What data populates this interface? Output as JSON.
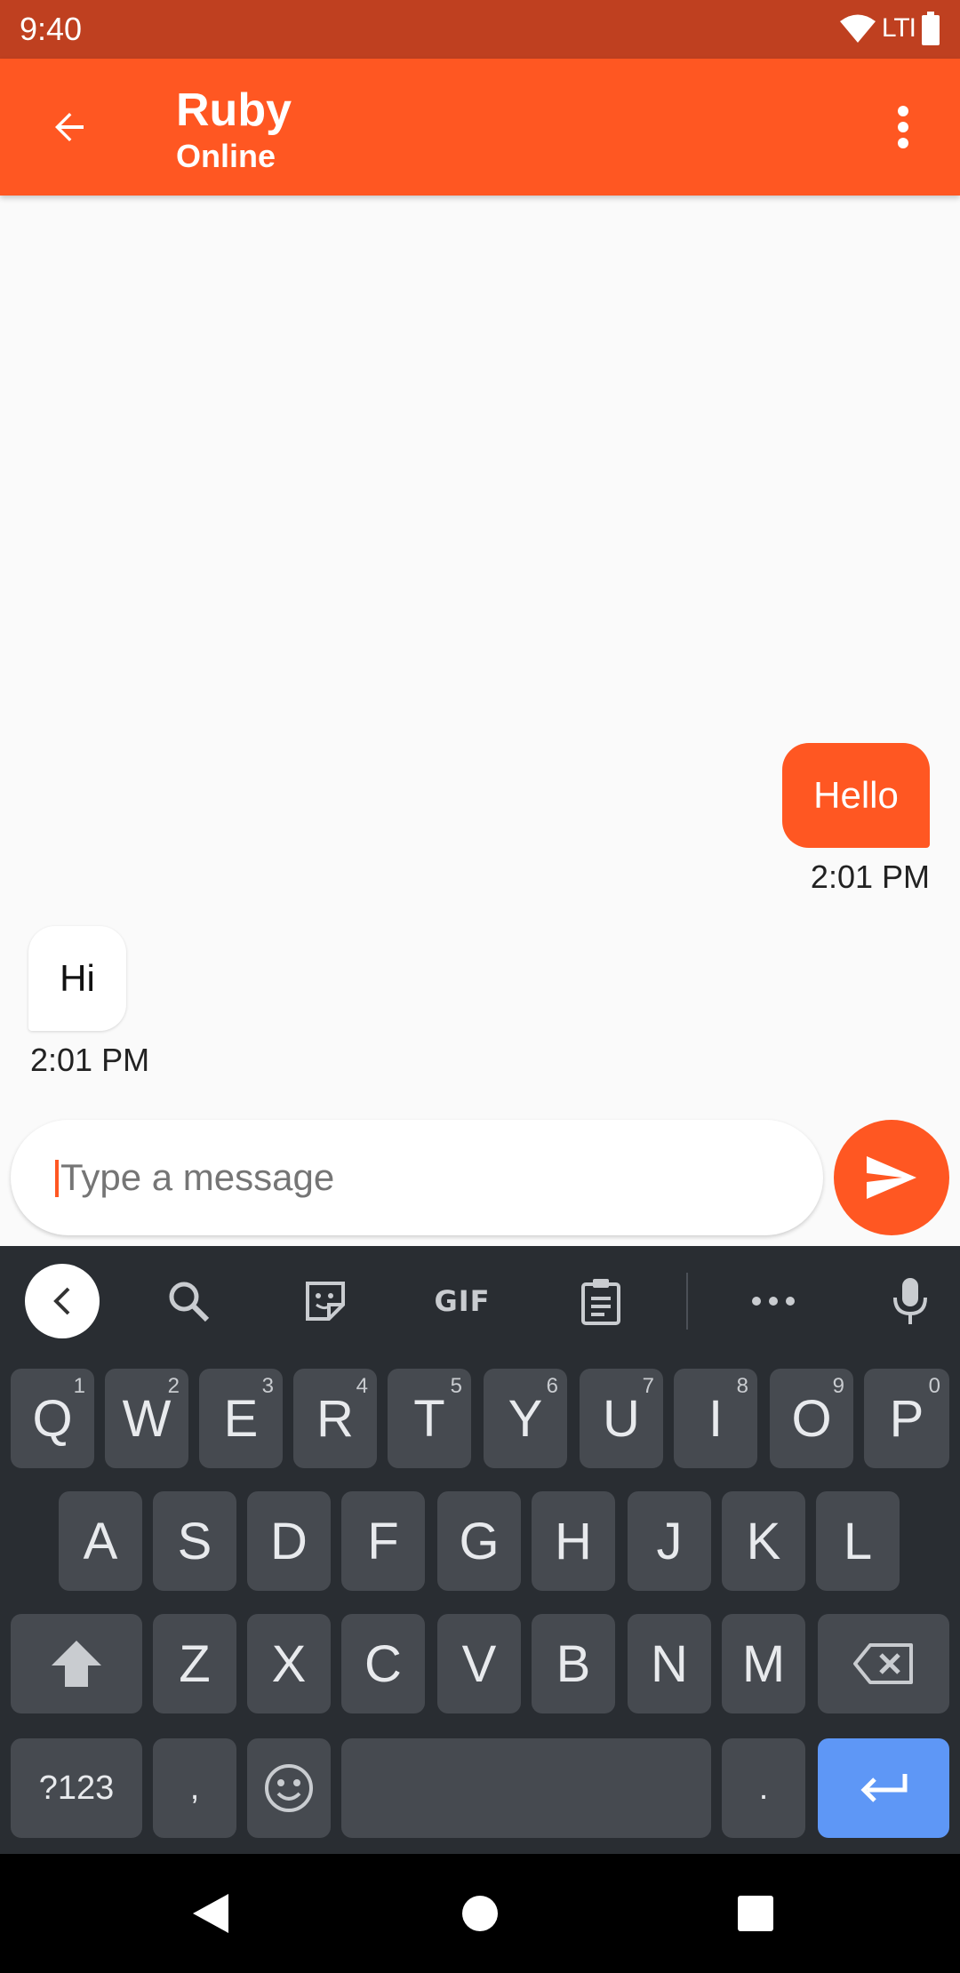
{
  "status_bar": {
    "time": "9:40",
    "network": "LTI"
  },
  "app_bar": {
    "contact_name": "Ruby",
    "contact_status": "Online"
  },
  "messages": [
    {
      "direction": "outgoing",
      "text": "Hello",
      "time": "2:01 PM"
    },
    {
      "direction": "incoming",
      "text": "Hi",
      "time": "2:01 PM"
    }
  ],
  "composer": {
    "placeholder": "Type a message",
    "value": ""
  },
  "keyboard": {
    "toolbar": {
      "gif_label": "GIF"
    },
    "row1": [
      {
        "label": "Q",
        "hint": "1"
      },
      {
        "label": "W",
        "hint": "2"
      },
      {
        "label": "E",
        "hint": "3"
      },
      {
        "label": "R",
        "hint": "4"
      },
      {
        "label": "T",
        "hint": "5"
      },
      {
        "label": "Y",
        "hint": "6"
      },
      {
        "label": "U",
        "hint": "7"
      },
      {
        "label": "I",
        "hint": "8"
      },
      {
        "label": "O",
        "hint": "9"
      },
      {
        "label": "P",
        "hint": "0"
      }
    ],
    "row2": [
      "A",
      "S",
      "D",
      "F",
      "G",
      "H",
      "J",
      "K",
      "L"
    ],
    "row3": [
      "Z",
      "X",
      "C",
      "V",
      "B",
      "N",
      "M"
    ],
    "row4": {
      "symbols": "?123",
      "comma": ",",
      "period": "."
    }
  },
  "colors": {
    "accent": "#ff5722",
    "status_bar": "#bf4020",
    "keyboard_bg": "#292d32",
    "key_bg": "#464a50",
    "enter_key": "#5e97f6"
  }
}
